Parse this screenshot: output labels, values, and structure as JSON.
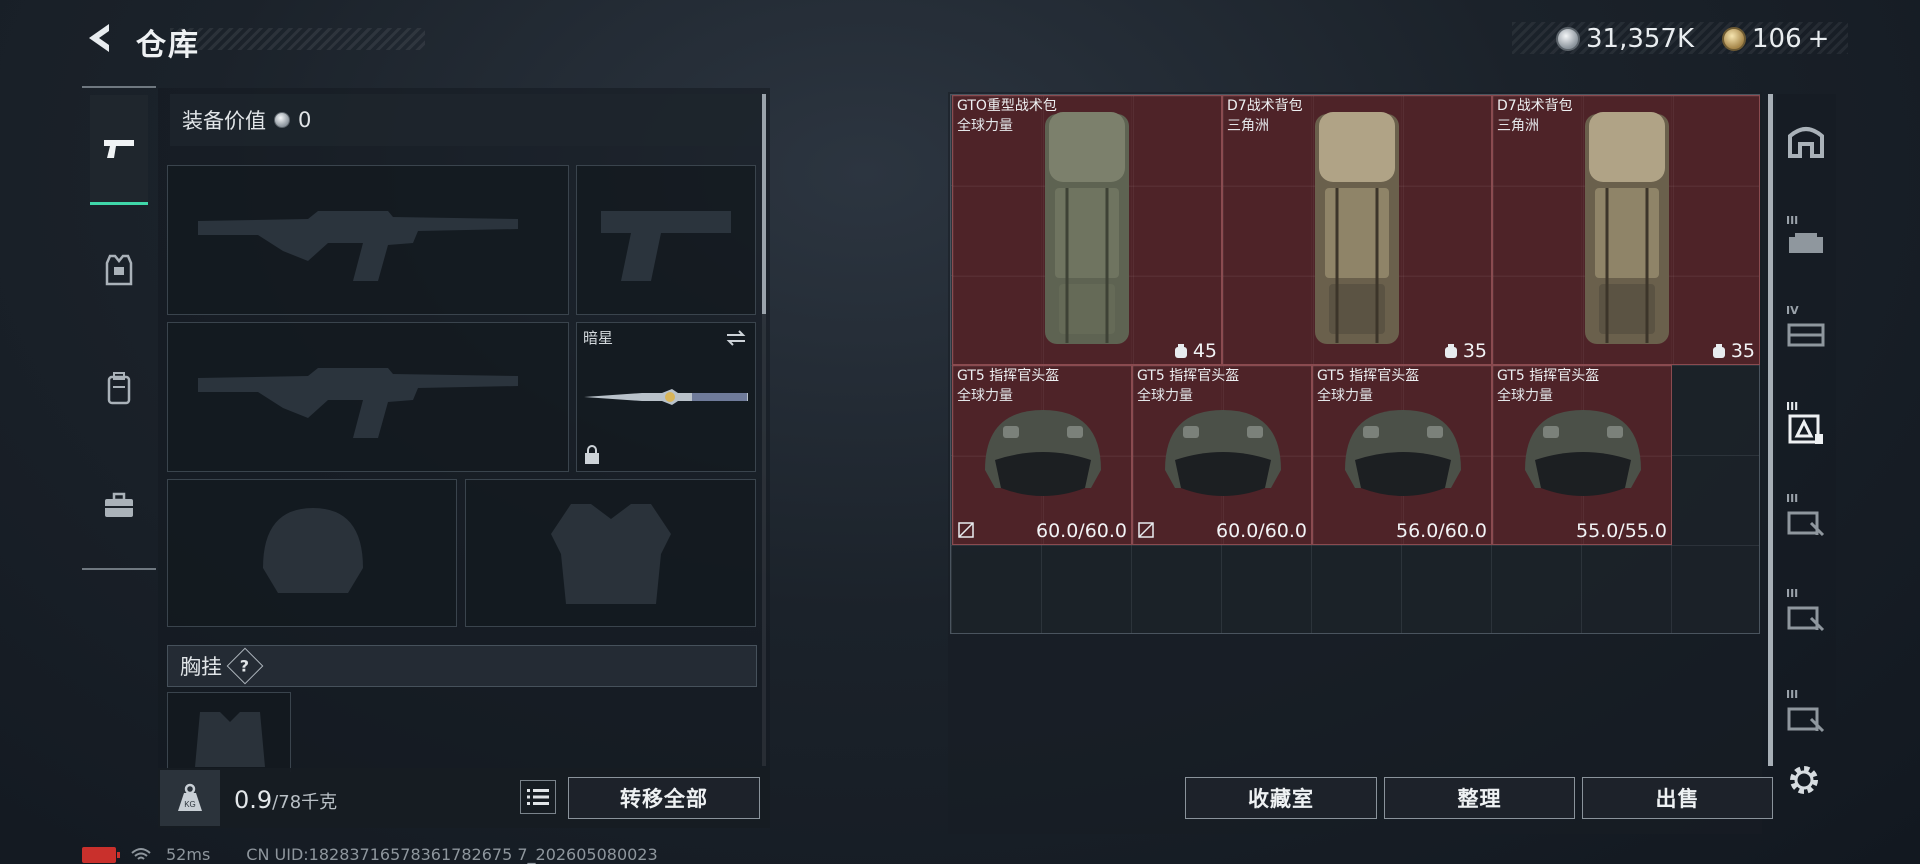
{
  "header": {
    "title": "仓库",
    "currency_silver": "31,357K",
    "currency_gold": "106",
    "currency_add": "+"
  },
  "equipment": {
    "value_label": "装备价值",
    "value": "0",
    "melee_label": "暗星",
    "chest_rig_label": "胸挂",
    "chest_rig_help": "?",
    "weight_value": "0.9",
    "weight_unit": "/78千克",
    "transfer_all": "转移全部"
  },
  "storage": {
    "items": [
      {
        "name": "GTO重型战术包",
        "sub": "全球力量",
        "value": "45"
      },
      {
        "name": "D7战术背包",
        "sub": "三角洲",
        "value": "35"
      },
      {
        "name": "D7战术背包",
        "sub": "三角洲",
        "value": "35"
      },
      {
        "name": "GT5 指挥官头盔",
        "sub": "全球力量",
        "value": "60.0/60.0"
      },
      {
        "name": "GT5 指挥官头盔",
        "sub": "全球力量",
        "value": "60.0/60.0"
      },
      {
        "name": "GT5 指挥官头盔",
        "sub": "全球力量",
        "value": "56.0/60.0"
      },
      {
        "name": "GT5 指挥官头盔",
        "sub": "全球力量",
        "value": "55.0/55.0"
      }
    ],
    "buttons": {
      "collection": "收藏室",
      "organize": "整理",
      "sell": "出售"
    }
  },
  "right_rail": {
    "tab_numbers": [
      "III",
      "IV",
      "III",
      "III",
      "III",
      "III"
    ]
  },
  "status": {
    "ping": "52ms",
    "uid": "CN UID:18283716578361782675 7_202605080023"
  },
  "colors": {
    "accent": "#3fd7a9",
    "item_bg": "#62242a"
  }
}
